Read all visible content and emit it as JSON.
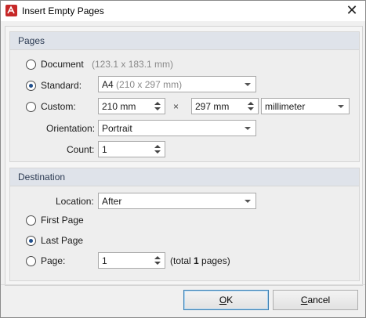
{
  "window": {
    "title": "Insert Empty Pages",
    "close_glyph": "✕"
  },
  "pages": {
    "group_title": "Pages",
    "document": {
      "label": "Document",
      "info": "(123.1 x 183.1 mm)",
      "selected": false
    },
    "standard": {
      "label": "Standard:",
      "selected": true,
      "value_main": "A4",
      "value_info": "(210 x 297 mm)"
    },
    "custom": {
      "label": "Custom:",
      "selected": false,
      "width": "210 mm",
      "times": "×",
      "height": "297 mm",
      "unit": "millimeter"
    },
    "orientation": {
      "label": "Orientation:",
      "value": "Portrait"
    },
    "count": {
      "label": "Count:",
      "value": "1"
    }
  },
  "destination": {
    "group_title": "Destination",
    "location": {
      "label": "Location:",
      "value": "After"
    },
    "first_page": {
      "label": "First Page",
      "selected": false
    },
    "last_page": {
      "label": "Last Page",
      "selected": true
    },
    "page": {
      "label": "Page:",
      "selected": false,
      "value": "1",
      "total_prefix": "(total ",
      "total_count": "1",
      "total_suffix": " pages)"
    }
  },
  "buttons": {
    "ok_mnemonic": "O",
    "ok_rest": "K",
    "cancel_mnemonic": "C",
    "cancel_rest": "ancel"
  },
  "colors": {
    "accent": "#1f4e8c",
    "group_header": "#dfe3ea",
    "app_icon": "#c62828"
  }
}
